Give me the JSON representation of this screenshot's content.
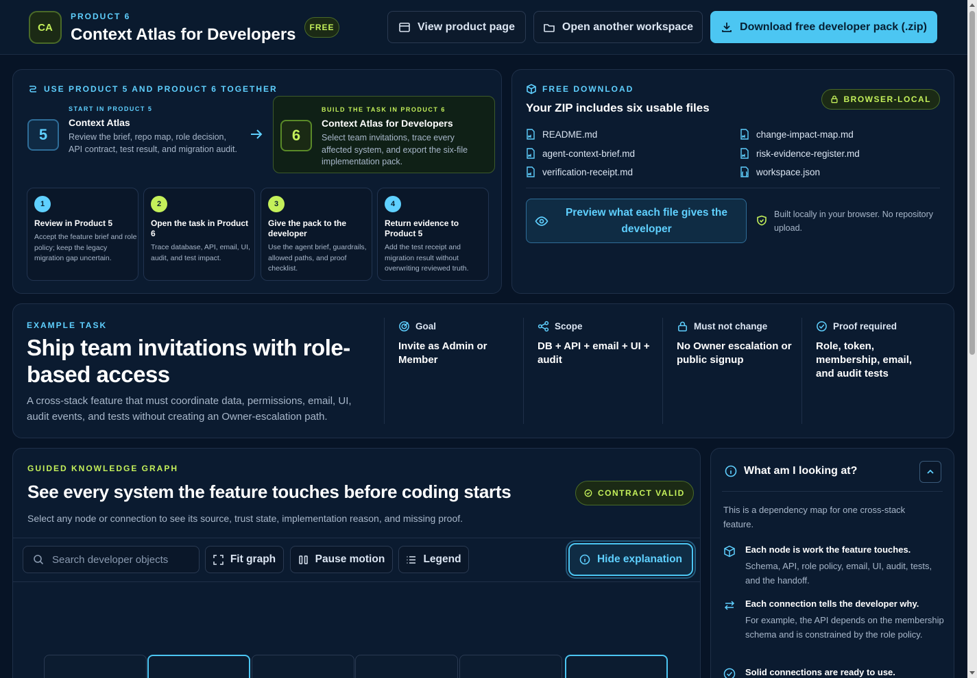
{
  "header": {
    "logo_text": "CA",
    "product_label": "PRODUCT 6",
    "title": "Context Atlas for Developers",
    "free_badge": "FREE",
    "view_product_label": "View product page",
    "open_workspace_label": "Open another workspace",
    "download_label": "Download free developer pack (.zip)"
  },
  "together": {
    "kicker": "USE PRODUCT 5 AND PRODUCT 6 TOGETHER",
    "stage5": {
      "number": "5",
      "kicker": "START IN PRODUCT 5",
      "title": "Context Atlas",
      "desc": "Review the brief, repo map, role decision, API contract, test result, and migration audit."
    },
    "stage6": {
      "number": "6",
      "kicker": "BUILD THE TASK IN PRODUCT 6",
      "title": "Context Atlas for Developers",
      "desc": "Select team invitations, trace every affected system, and export the six-file implementation pack."
    },
    "steps": [
      {
        "num": "1",
        "title": "Review in Product 5",
        "desc": "Accept the feature brief and role policy; keep the legacy migration gap uncertain."
      },
      {
        "num": "2",
        "title": "Open the task in Product 6",
        "desc": "Trace database, API, email, UI, audit, and test impact."
      },
      {
        "num": "3",
        "title": "Give the pack to the developer",
        "desc": "Use the agent brief, guardrails, allowed paths, and proof checklist."
      },
      {
        "num": "4",
        "title": "Return evidence to Product 5",
        "desc": "Add the test receipt and migration result without overwriting reviewed truth."
      }
    ]
  },
  "download": {
    "kicker": "FREE DOWNLOAD",
    "title": "Your ZIP includes six usable files",
    "badge": "BROWSER-LOCAL",
    "files": [
      "README.md",
      "change-impact-map.md",
      "agent-context-brief.md",
      "risk-evidence-register.md",
      "verification-receipt.md",
      "workspace.json"
    ],
    "preview_label": "Preview what each file gives the developer",
    "local_note": "Built locally in your browser. No repository upload."
  },
  "example": {
    "kicker": "EXAMPLE TASK",
    "title": "Ship team invitations with role-based access",
    "desc": "A cross-stack feature that must coordinate data, permissions, email, UI, audit events, and tests without creating an Owner-escalation path.",
    "attributes": [
      {
        "label": "Goal",
        "value": "Invite as Admin or Member"
      },
      {
        "label": "Scope",
        "value": "DB + API + email + UI + audit"
      },
      {
        "label": "Must not change",
        "value": "No Owner escalation or public signup"
      },
      {
        "label": "Proof required",
        "value": "Role, token, membership, email, and audit tests"
      }
    ]
  },
  "graph": {
    "kicker": "GUIDED KNOWLEDGE GRAPH",
    "title": "See every system the feature touches before coding starts",
    "subtitle": "Select any node or connection to see its source, trust state, implementation reason, and missing proof.",
    "badge": "CONTRACT VALID",
    "search_placeholder": "Search developer objects",
    "fit_label": "Fit graph",
    "pause_label": "Pause motion",
    "legend_label": "Legend",
    "hide_label": "Hide explanation"
  },
  "info": {
    "title": "What am I looking at?",
    "intro": "This is a dependency map for one cross-stack feature.",
    "items": [
      {
        "title": "Each node is work the feature touches.",
        "desc": "Schema, API, role policy, email, UI, audit, tests, and the handoff."
      },
      {
        "title": "Each connection tells the developer why.",
        "desc": "For example, the API depends on the membership schema and is constrained by the role policy."
      },
      {
        "title": "Solid connections are ready to use.",
        "desc": ""
      }
    ]
  },
  "colors": {
    "accent_blue": "#4cc6f2",
    "accent_green": "#c4f05a",
    "background": "#071426"
  }
}
